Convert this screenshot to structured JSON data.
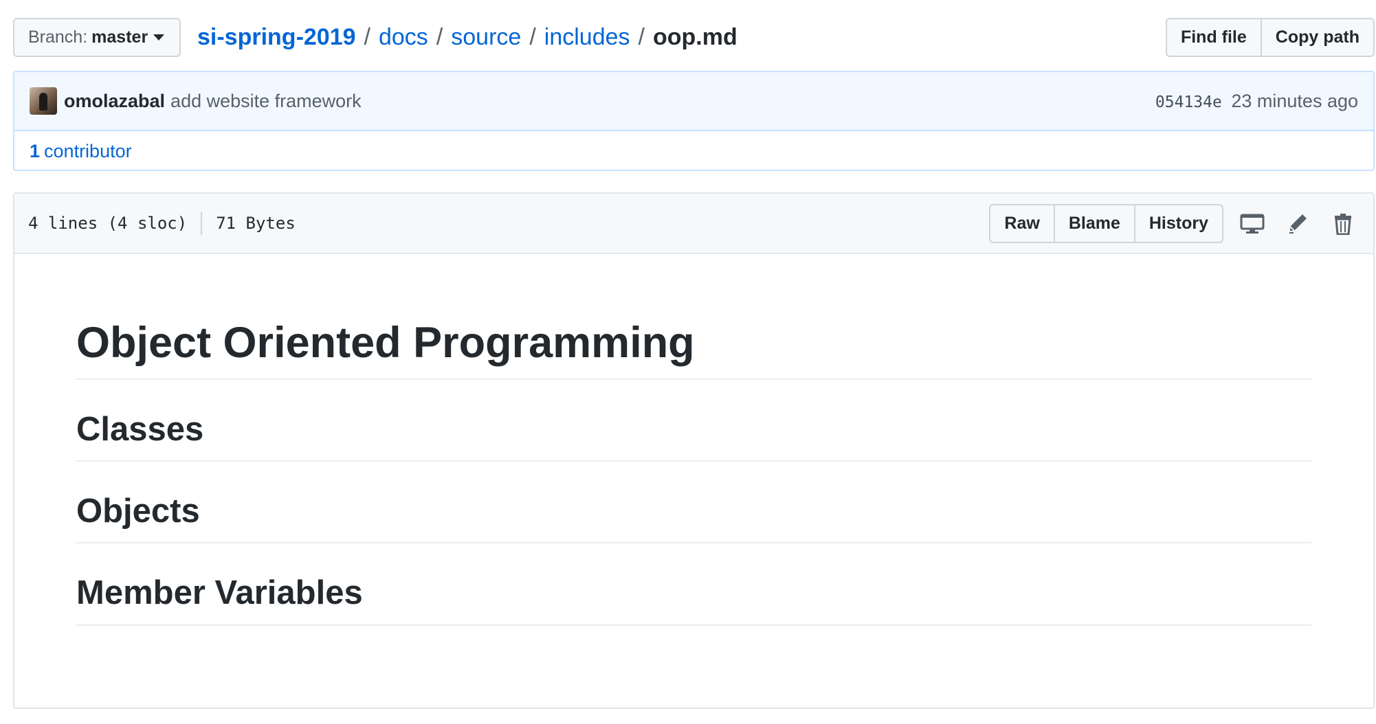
{
  "branch": {
    "label": "Branch:",
    "value": "master"
  },
  "breadcrumb": {
    "repo": "si-spring-2019",
    "dirs": [
      "docs",
      "source",
      "includes"
    ],
    "separator": "/",
    "file": "oop.md"
  },
  "top_actions": {
    "find_file": "Find file",
    "copy_path": "Copy path"
  },
  "commit": {
    "author": "omolazabal",
    "message": "add website framework",
    "sha": "054134e",
    "time": "23 minutes ago"
  },
  "contributors": {
    "count": "1",
    "label": "contributor"
  },
  "file_info": {
    "lines": "4 lines (4 sloc)",
    "size": "71 Bytes"
  },
  "file_actions": {
    "raw": "Raw",
    "blame": "Blame",
    "history": "History"
  },
  "icons": [
    "desktop-icon",
    "pencil-icon",
    "trash-icon"
  ],
  "content": {
    "h1": "Object Oriented Programming",
    "headings": [
      "Classes",
      "Objects",
      "Member Variables"
    ]
  },
  "colors": {
    "link": "#0366d6",
    "text": "#24292e",
    "muted": "#586069",
    "commit_bg": "#f1f8ff",
    "border_blue": "#c8e1ff"
  }
}
